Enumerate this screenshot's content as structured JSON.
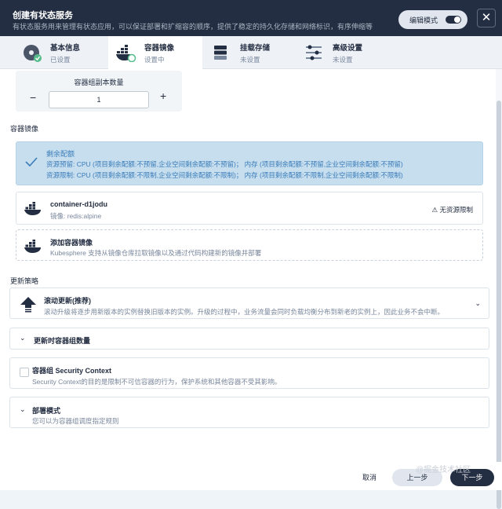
{
  "header": {
    "title": "创建有状态服务",
    "description": "有状态服务用来管理有状态应用，可以保证部署和扩缩容的顺序，提供了稳定的持久化存储和网络标识，有序伸缩等",
    "mode_label": "编辑模式",
    "close_label": "✕"
  },
  "steps": [
    {
      "name": "基本信息",
      "status": "已设置"
    },
    {
      "name": "容器镜像",
      "status": "设置中"
    },
    {
      "name": "挂载存储",
      "status": "未设置"
    },
    {
      "name": "高级设置",
      "status": "未设置"
    }
  ],
  "replicas": {
    "label": "容器组副本数量",
    "value": "1",
    "minus": "−",
    "plus": "+"
  },
  "container_image_label": "容器镜像",
  "quota": {
    "title": "剩余配额",
    "line1": "资源预留: CPU (项目剩余配额:不预留,企业空间剩余配额:不预留)；  内存 (项目剩余配额:不预留,企业空间剩余配额:不预留)",
    "line2": "资源限制: CPU (项目剩余配额:不限制,企业空间剩余配额:不限制)；  内存 (项目剩余配额:不限制,企业空间剩余配额:不限制)"
  },
  "container": {
    "name": "container-d1jodu",
    "image": "镜像: redis:alpine",
    "limit": "无资源限制"
  },
  "add_image": {
    "title": "添加容器镜像",
    "desc": "Kubesphere 支持从镜像仓库拉取镜像以及通过代码构建新的镜像并部署"
  },
  "update_strategy_label": "更新策略",
  "rolling": {
    "title": "滚动更新(推荐)",
    "desc": "滚动升级将逐步用新版本的实例替换旧版本的实例。升级的过程中，业务流量会同时负载均衡分布到新老的实例上，因此业务不会中断。"
  },
  "pod_count": {
    "title": "更新时容器组数量"
  },
  "security": {
    "title": "容器组 Security Context",
    "desc": "Security Context的目的是限制不可信容器的行为，保护系统和其他容器不受其影响。"
  },
  "deploy": {
    "title": "部署模式",
    "desc": "您可以为容器组调度指定规则"
  },
  "footer": {
    "cancel": "取消",
    "prev": "上一步",
    "next": "下一步"
  },
  "watermark": "@掘金技术社区",
  "colors": {
    "primary": "#242e42",
    "info_bg": "#c7deef",
    "info_text": "#3a7cb8"
  }
}
